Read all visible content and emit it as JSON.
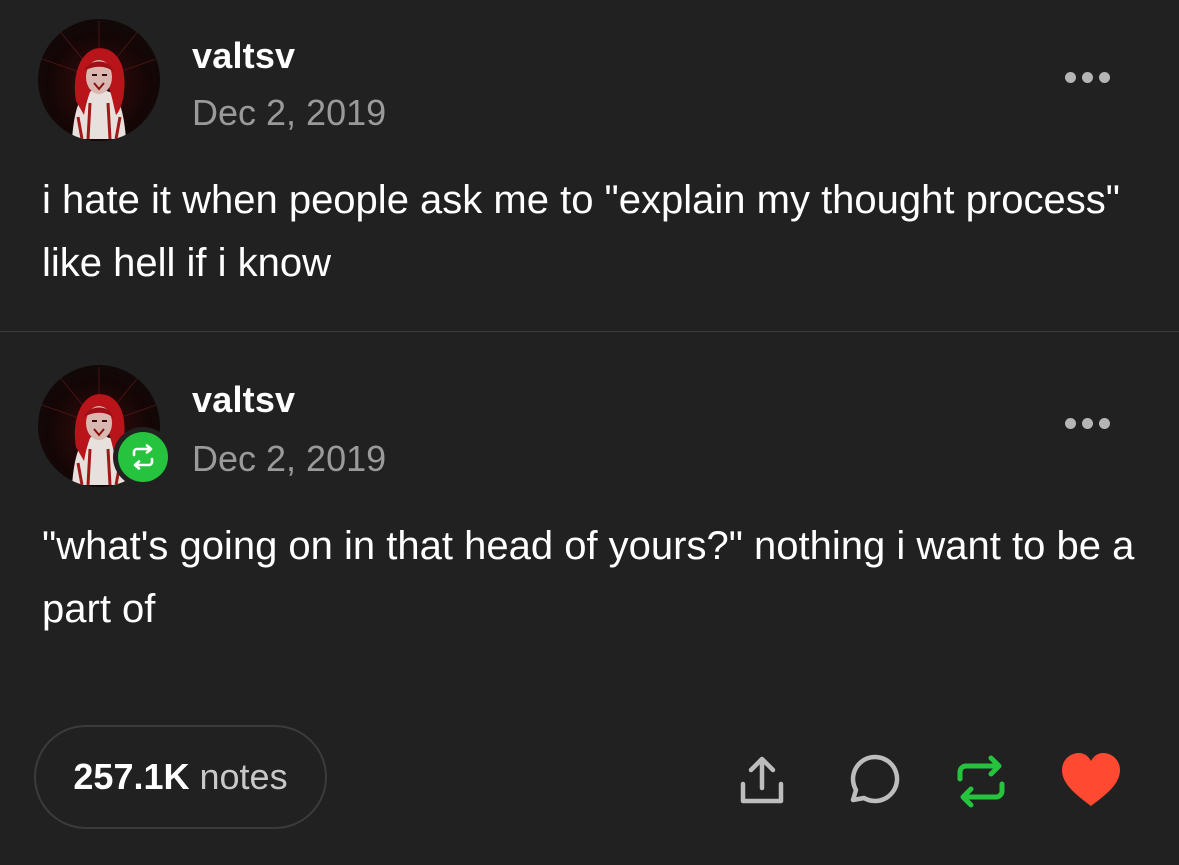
{
  "posts": [
    {
      "username": "valtsv",
      "date": "Dec 2, 2019",
      "text": "i hate it when people ask me to \"explain my thought process\" like hell if i know",
      "avatar_icon": "avatar-image",
      "more_icon": "more-options-icon"
    },
    {
      "username": "valtsv",
      "date": "Dec 2, 2019",
      "text": "\"what's going on in that head of yours?\" nothing i want to be a part of",
      "avatar_icon": "avatar-image",
      "badge_icon": "reblog-badge-icon",
      "more_icon": "more-options-icon"
    }
  ],
  "footer": {
    "notes_count": "257.1K",
    "notes_label": "notes",
    "actions": [
      {
        "name": "share",
        "icon": "share-icon"
      },
      {
        "name": "reply",
        "icon": "reply-icon"
      },
      {
        "name": "reblog",
        "icon": "reblog-icon"
      },
      {
        "name": "like",
        "icon": "heart-icon"
      }
    ]
  },
  "colors": {
    "background": "#212121",
    "text": "#ffffff",
    "muted": "#9a9a9a",
    "reblog_green": "#26c33e",
    "like_red": "#ff4930"
  }
}
